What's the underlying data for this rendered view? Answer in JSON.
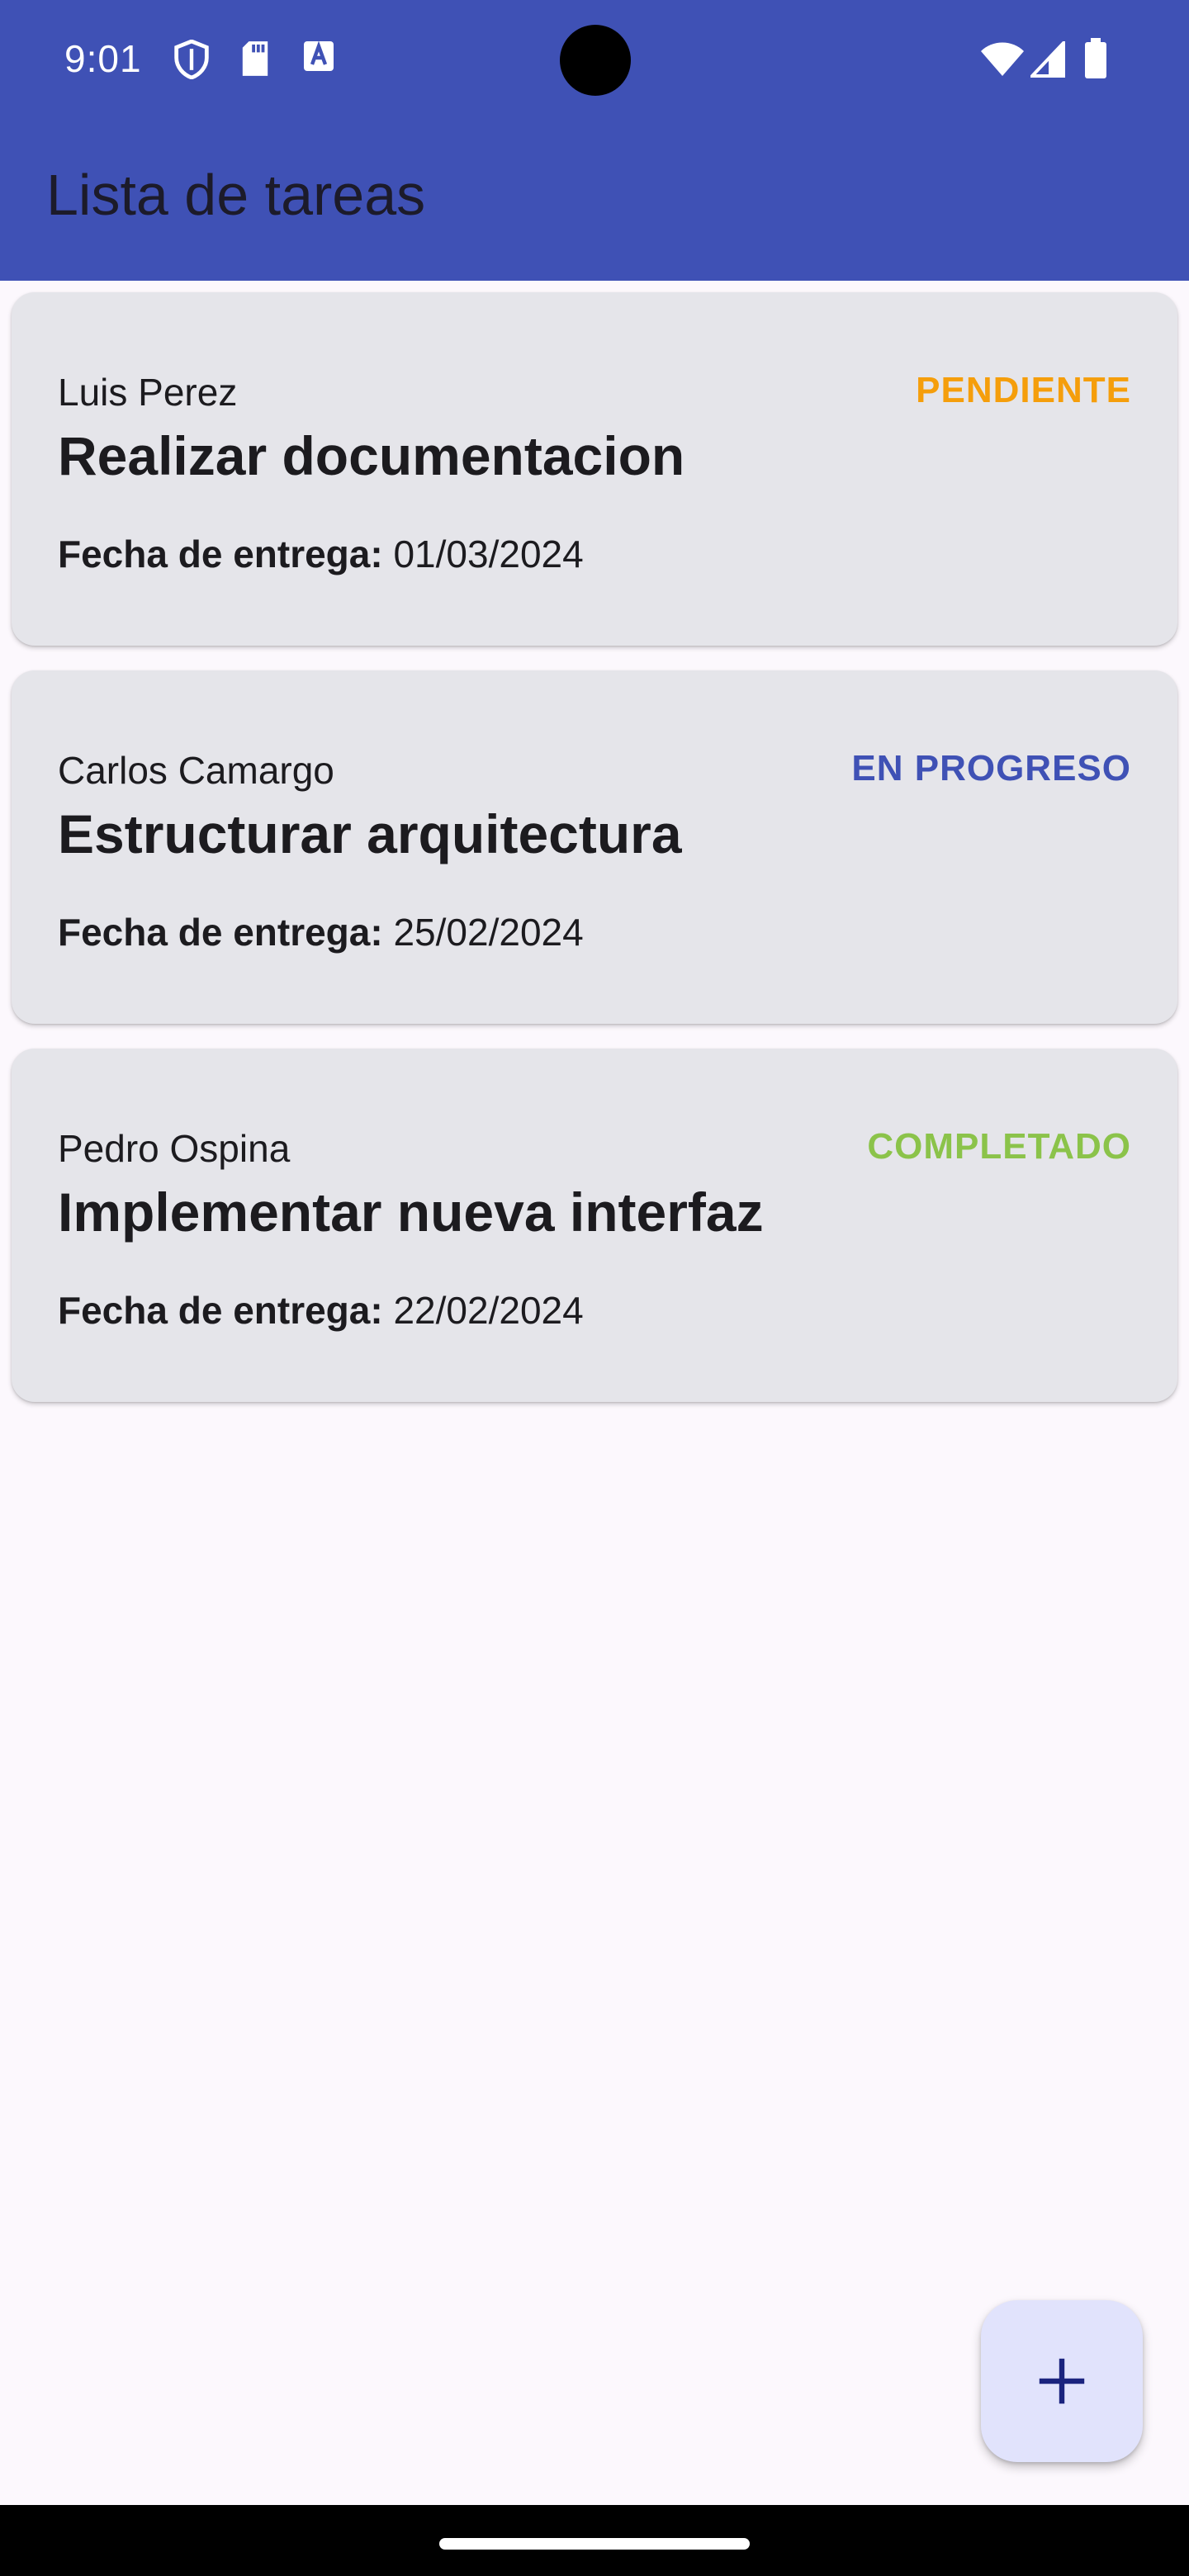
{
  "status_bar": {
    "time": "9:01",
    "icons": [
      "shield-icon",
      "sd-card-icon",
      "font-a-icon",
      "wifi-icon",
      "signal-icon",
      "battery-icon"
    ]
  },
  "app_bar": {
    "title": "Lista de tareas",
    "color": "#3f51b5"
  },
  "tasks": [
    {
      "assignee": "Luis Perez",
      "status": "PENDIENTE",
      "status_color": "#f59e0b",
      "title": "Realizar documentacion",
      "due_label": "Fecha de entrega:",
      "due_date": "01/03/2024"
    },
    {
      "assignee": "Carlos Camargo",
      "status": "EN PROGRESO",
      "status_color": "#3f51b5",
      "title": "Estructurar arquitectura",
      "due_label": "Fecha de entrega:",
      "due_date": "25/02/2024"
    },
    {
      "assignee": "Pedro Ospina",
      "status": "COMPLETADO",
      "status_color": "#8bc34a",
      "title": "Implementar nueva interfaz",
      "due_label": "Fecha de entrega:",
      "due_date": "22/02/2024"
    }
  ],
  "fab": {
    "icon": "add-icon"
  }
}
